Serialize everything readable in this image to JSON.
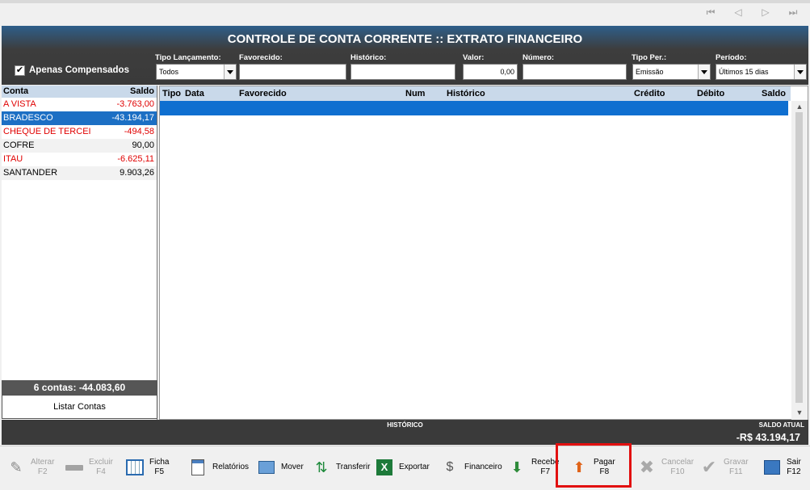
{
  "header": {
    "title": "CONTROLE DE CONTA CORRENTE :: EXTRATO FINANCEIRO"
  },
  "filters": {
    "apenas_compensados": {
      "label": "Apenas Compensados",
      "checked": true
    },
    "tipo_lancamento": {
      "label": "Tipo Lançamento:",
      "value": "Todos"
    },
    "favorecido": {
      "label": "Favorecido:",
      "value": ""
    },
    "historico": {
      "label": "Histórico:",
      "value": ""
    },
    "valor": {
      "label": "Valor:",
      "value": "0,00"
    },
    "numero": {
      "label": "Número:",
      "value": ""
    },
    "tipo_per": {
      "label": "Tipo Per.:",
      "value": "Emissão"
    },
    "periodo": {
      "label": "Período:",
      "value": "Últimos 15 dias"
    }
  },
  "accounts": {
    "col_conta": "Conta",
    "col_saldo": "Saldo",
    "rows": [
      {
        "name": "A VISTA",
        "saldo": "-3.763,00"
      },
      {
        "name": "BRADESCO",
        "saldo": "-43.194,17"
      },
      {
        "name": "CHEQUE DE TERCEIROS",
        "saldo": "-494,58"
      },
      {
        "name": "COFRE",
        "saldo": "90,00"
      },
      {
        "name": "ITAU",
        "saldo": "-6.625,11"
      },
      {
        "name": "SANTANDER",
        "saldo": "9.903,26"
      }
    ],
    "summary": "6 contas: -44.083,60",
    "list_button": "Listar Contas"
  },
  "grid": {
    "columns": [
      "Tipo",
      "Data",
      "Favorecido",
      "Num",
      "Histórico",
      "Crédito",
      "Débito",
      "Saldo"
    ]
  },
  "status": {
    "historico_label": "HISTÓRICO",
    "saldo_label": "SALDO ATUAL",
    "saldo_value": "-R$ 43.194,17"
  },
  "toolbar": {
    "alterar": {
      "label": "Alterar",
      "key": "F2"
    },
    "excluir": {
      "label": "Excluir",
      "key": "F4"
    },
    "ficha": {
      "label": "Ficha",
      "key": "F5"
    },
    "relatorios": {
      "label": "Relatórios"
    },
    "mover": {
      "label": "Mover"
    },
    "transferir": {
      "label": "Transferir"
    },
    "exportar": {
      "label": "Exportar"
    },
    "financeiro": {
      "label": "Financeiro"
    },
    "receber": {
      "label": "Recebe",
      "key": "F7"
    },
    "pagar": {
      "label": "Pagar",
      "key": "F8"
    },
    "cancelar": {
      "label": "Cancelar",
      "key": "F10"
    },
    "gravar": {
      "label": "Gravar",
      "key": "F11"
    },
    "sair": {
      "label": "Sair",
      "key": "F12"
    }
  }
}
